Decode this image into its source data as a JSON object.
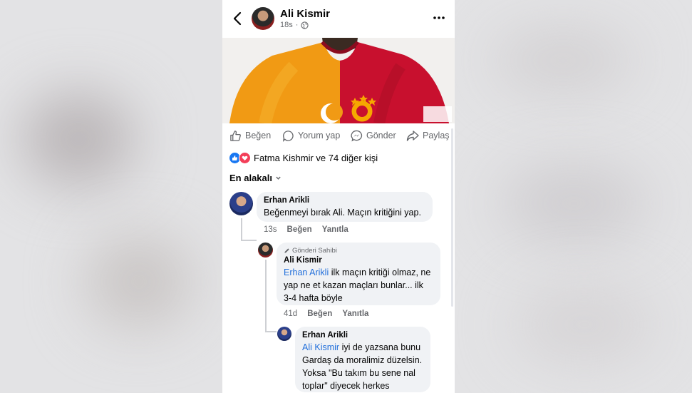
{
  "header": {
    "author": "Ali Kismir",
    "time": "18s"
  },
  "actions": {
    "like": "Beğen",
    "comment": "Yorum yap",
    "send": "Gönder",
    "share": "Paylaş"
  },
  "reactions": {
    "summary": "Fatma Kishmir ve 74 diğer kişi"
  },
  "sort": {
    "label": "En alakalı"
  },
  "comments": [
    {
      "name": "Erhan Arikli",
      "text": "Beğenmeyi bırak Ali. Maçın kritiğini yap.",
      "time": "13s",
      "like": "Beğen",
      "reply": "Yanıtla"
    },
    {
      "badge": "Gönderi Sahibi",
      "name": "Ali Kismir",
      "mention": "Erhan Arikli",
      "text": " ilk maçın kritiği olmaz, ne yap ne et kazan maçları bunlar... ilk 3-4 hafta böyle",
      "time": "41d",
      "like": "Beğen",
      "reply": "Yanıtla"
    },
    {
      "name": "Erhan Arikli",
      "mention": "Ali Kismir",
      "text": " iyi de yazsana bunu Gardaş da moralimiz düzelsin. Yoksa \"Bu takım bu sene nal toplar\" diyecek herkes"
    }
  ],
  "colors": {
    "galatasaray_red": "#c8102e",
    "galatasaray_yellow": "#f6a800",
    "link_blue": "#216fdb",
    "bubble_bg": "#f0f2f5"
  }
}
